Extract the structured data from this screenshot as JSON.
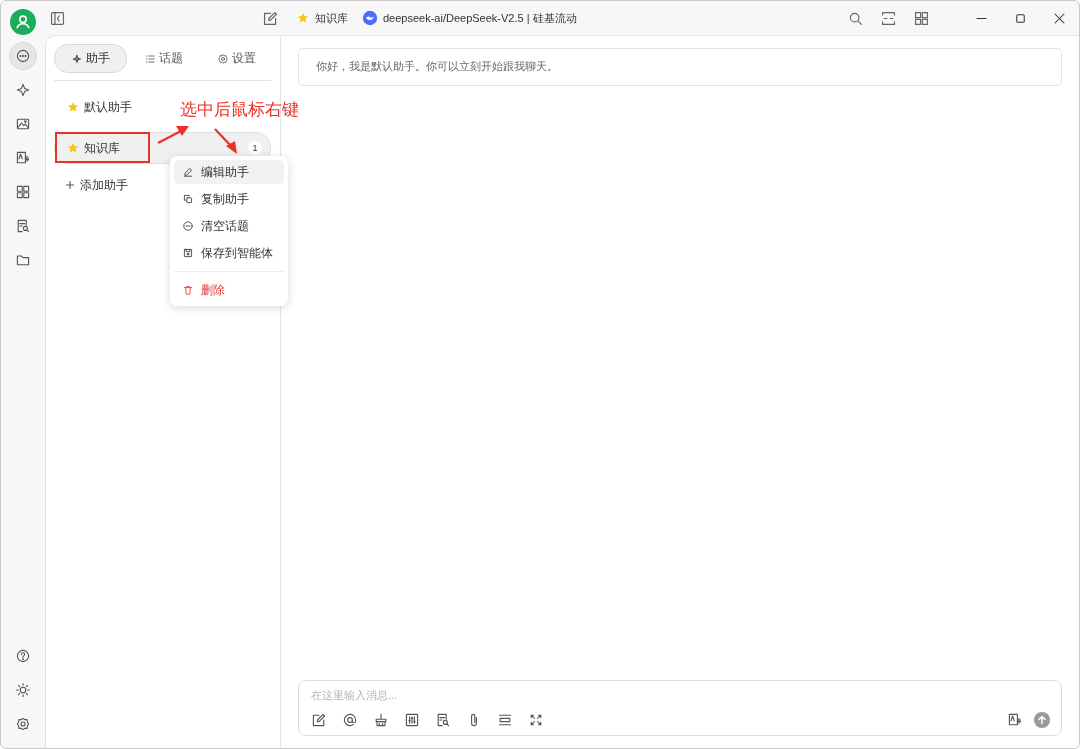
{
  "topbar": {
    "assistant": "知识库",
    "model": "deepseek-ai/DeepSeek-V2.5 | 硅基流动"
  },
  "nav": [
    {
      "kind": "chat",
      "selected": true
    },
    {
      "kind": "sparkle",
      "selected": false
    },
    {
      "kind": "image",
      "selected": false
    },
    {
      "kind": "translate",
      "selected": false
    },
    {
      "kind": "apps",
      "selected": false
    },
    {
      "kind": "doc-search",
      "selected": false
    },
    {
      "kind": "folder",
      "selected": false
    }
  ],
  "nav_bottom": [
    {
      "kind": "help"
    },
    {
      "kind": "sun"
    },
    {
      "kind": "settings"
    }
  ],
  "tabs": [
    {
      "label": "助手",
      "kind": "assistant",
      "selected": true
    },
    {
      "label": "话题",
      "kind": "topics",
      "selected": false
    },
    {
      "label": "设置",
      "kind": "settings",
      "selected": false
    }
  ],
  "assistants": [
    {
      "name": "默认助手",
      "selected": false
    },
    {
      "name": "知识库",
      "selected": true,
      "count": "1"
    }
  ],
  "add_assistant": "添加助手",
  "context_menu": [
    {
      "label": "编辑助手",
      "kind": "edit",
      "highlighted": true
    },
    {
      "label": "复制助手",
      "kind": "copy",
      "highlighted": false
    },
    {
      "label": "清空话题",
      "kind": "clear",
      "highlighted": false
    },
    {
      "label": "保存到智能体",
      "kind": "save",
      "highlighted": false
    },
    {
      "label": "删除",
      "kind": "delete",
      "highlighted": false
    }
  ],
  "annotation": "选中后鼠标右键",
  "greeting": "你好，我是默认助手。你可以立刻开始跟我聊天。",
  "input": {
    "placeholder": "在这里输入消息..."
  }
}
